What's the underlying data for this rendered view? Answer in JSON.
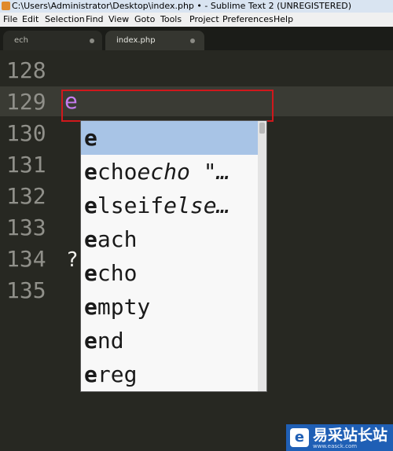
{
  "window": {
    "title": "C:\\Users\\Administrator\\Desktop\\index.php • - Sublime Text 2 (UNREGISTERED)"
  },
  "menu": [
    "File",
    "Edit",
    "Selection",
    "Find",
    "View",
    "Goto",
    "Tools",
    "Project",
    "Preferences",
    "Help"
  ],
  "tabs": [
    {
      "label": "ech",
      "active": false,
      "modified": true
    },
    {
      "label": "index.php",
      "active": true,
      "modified": true
    }
  ],
  "editor": {
    "line_numbers": [
      "128",
      "129",
      "130",
      "131",
      "132",
      "133",
      "134",
      "135"
    ],
    "current_line": "129",
    "typed_text": "e",
    "stray_text": "?",
    "typed_color": "#c67cf0"
  },
  "autocomplete": {
    "items": [
      {
        "match": "e",
        "rest": "",
        "hint": ""
      },
      {
        "match": "e",
        "rest": "cho",
        "hint": "echo \"…"
      },
      {
        "match": "e",
        "rest": "lseif",
        "hint": "else…"
      },
      {
        "match": "e",
        "rest": "ach",
        "hint": ""
      },
      {
        "match": "e",
        "rest": "cho",
        "hint": ""
      },
      {
        "match": "e",
        "rest": "mpty",
        "hint": ""
      },
      {
        "match": "e",
        "rest": "nd",
        "hint": ""
      },
      {
        "match": "e",
        "rest": "reg",
        "hint": ""
      }
    ],
    "selected_index": 0
  },
  "watermark": {
    "text": "易采站长站",
    "url": "www.easck.com"
  },
  "colors": {
    "background": "#272822",
    "line_number": "#90908a",
    "selection": "#a8c4e6",
    "highlight_box": "#d0181c"
  }
}
